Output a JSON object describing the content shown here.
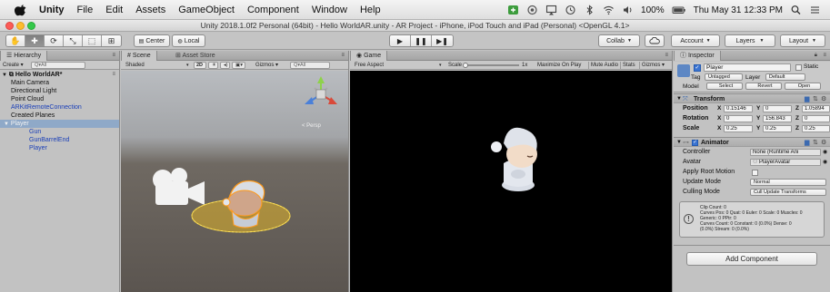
{
  "menubar": {
    "app_name": "Unity",
    "menus": [
      "File",
      "Edit",
      "Assets",
      "GameObject",
      "Component",
      "Window",
      "Help"
    ],
    "battery": "100%",
    "clock": "Thu May 31 12:33 PM"
  },
  "window": {
    "title": "Unity 2018.1.0f2 Personal (64bit) - Hello WorldAR.unity - AR Project - iPhone, iPod Touch and iPad (Personal) <OpenGL 4.1>"
  },
  "toolbar": {
    "pivot_label": "Center",
    "space_label": "Local",
    "collab_label": "Collab",
    "account_label": "Account",
    "layers_label": "Layers",
    "layout_label": "Layout"
  },
  "hierarchy": {
    "tab_label": "Hierarchy",
    "create_label": "Create",
    "search_placeholder": "Q▾All",
    "scene_name": "Hello WorldAR*",
    "items": [
      {
        "label": "Main Camera"
      },
      {
        "label": "Directional Light"
      },
      {
        "label": "Point Cloud"
      },
      {
        "label": "ARKitRemoteConnection"
      },
      {
        "label": "Created Planes"
      },
      {
        "label": "Player"
      },
      {
        "label": "Gun"
      },
      {
        "label": "GunBarrelEnd"
      },
      {
        "label": "Player"
      }
    ]
  },
  "scene": {
    "tab_label": "Scene",
    "asset_store_label": "Asset Store",
    "shading_label": "Shaded",
    "mode_2d": "2D",
    "gizmos_label": "Gizmos",
    "search_placeholder": "Q▾All",
    "persp_label": "< Persp"
  },
  "game": {
    "tab_label": "Game",
    "aspect_label": "Free Aspect",
    "scale_label": "Scale",
    "scale_value": "1x",
    "buttons": [
      "Maximize On Play",
      "Mute Audio",
      "Stats",
      "Gizmos"
    ]
  },
  "inspector": {
    "tab_label": "Inspector",
    "object_name": "Player",
    "static_label": "Static",
    "tag_label": "Tag",
    "tag_value": "Untagged",
    "layer_label": "Layer",
    "layer_value": "Default",
    "model_label": "Model",
    "model_buttons": [
      "Select",
      "Revert",
      "Open"
    ],
    "transform": {
      "title": "Transform",
      "position_label": "Position",
      "rotation_label": "Rotation",
      "scale_label": "Scale",
      "position": {
        "x": "0.15146",
        "y": "0",
        "z": "1.05894"
      },
      "rotation": {
        "x": "0",
        "y": "156.843",
        "z": "0"
      },
      "scale": {
        "x": "0.25",
        "y": "0.25",
        "z": "0.25"
      }
    },
    "animator": {
      "title": "Animator",
      "fields": [
        {
          "label": "Controller",
          "value": "None (Runtime Ani"
        },
        {
          "label": "Avatar",
          "value": "PlayerAvatar"
        },
        {
          "label": "Apply Root Motion",
          "value": ""
        },
        {
          "label": "Update Mode",
          "value": "Normal"
        },
        {
          "label": "Culling Mode",
          "value": "Cull Update Transforms"
        }
      ],
      "info_lines": [
        "Clip Count: 0",
        "Curves Pos: 0 Quat: 0 Euler: 0 Scale: 0 Muscles: 0",
        "Generic: 0 PPtr: 0",
        "Curves Count: 0 Constant: 0 (0.0%) Dense: 0",
        "(0.0%) Stream: 0 (0.0%)"
      ]
    },
    "add_component_label": "Add Component"
  }
}
